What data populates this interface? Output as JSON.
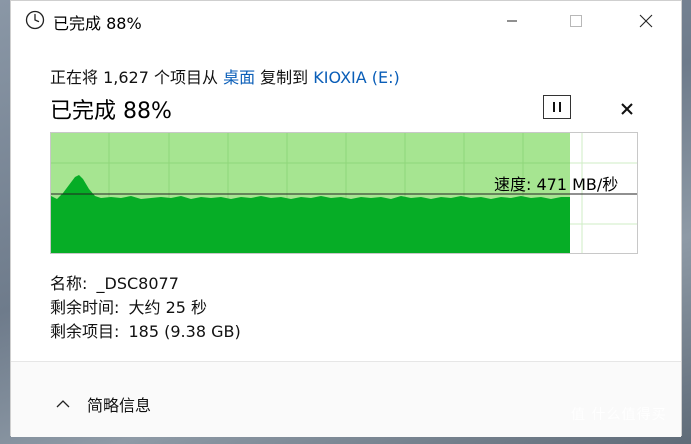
{
  "window": {
    "title": "已完成 88%",
    "icon": "clock-icon"
  },
  "copy": {
    "prefix": "正在将 1,627 个项目从 ",
    "source": "桌面",
    "middle": " 复制到 ",
    "destination": "KIOXIA (E:)"
  },
  "progress": {
    "title": "已完成 88%",
    "percent": 88,
    "speed_label": "速度: 471 MB/秒"
  },
  "details": {
    "name_label": "名称:",
    "name_value": "_DSC8077",
    "time_label": "剩余时间:",
    "time_value": "大约 25 秒",
    "items_label": "剩余项目:",
    "items_value": "185 (9.38 GB)"
  },
  "footer": {
    "less_info_label": "简略信息"
  },
  "watermark": {
    "text": "值 什么值得买"
  },
  "colors": {
    "graph_fill": "#06ad26",
    "graph_done": "#a6e591",
    "graph_grid": "#c9ecbf",
    "link": "#0a5eb8"
  }
}
